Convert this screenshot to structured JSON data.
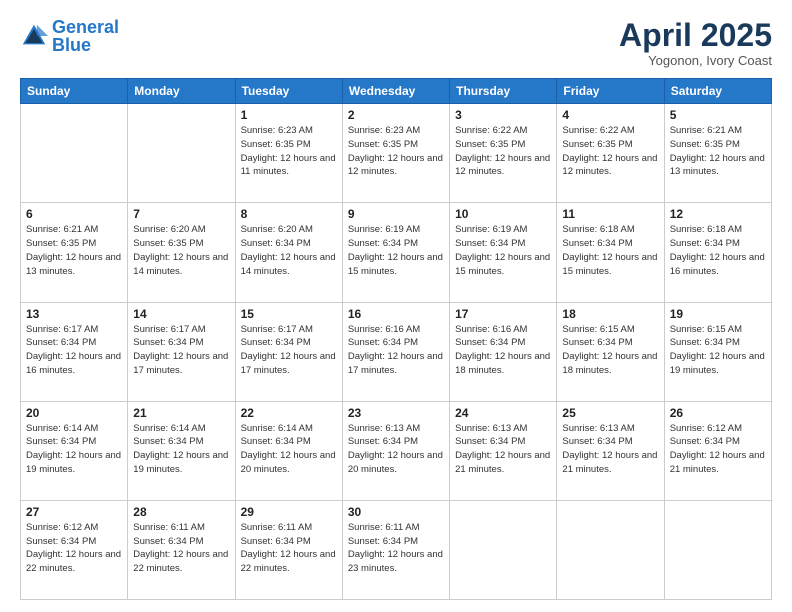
{
  "header": {
    "logo_general": "General",
    "logo_blue": "Blue",
    "title": "April 2025",
    "subtitle": "Yogonon, Ivory Coast"
  },
  "weekdays": [
    "Sunday",
    "Monday",
    "Tuesday",
    "Wednesday",
    "Thursday",
    "Friday",
    "Saturday"
  ],
  "weeks": [
    [
      {
        "day": "",
        "info": ""
      },
      {
        "day": "",
        "info": ""
      },
      {
        "day": "1",
        "info": "Sunrise: 6:23 AM\nSunset: 6:35 PM\nDaylight: 12 hours and 11 minutes."
      },
      {
        "day": "2",
        "info": "Sunrise: 6:23 AM\nSunset: 6:35 PM\nDaylight: 12 hours and 12 minutes."
      },
      {
        "day": "3",
        "info": "Sunrise: 6:22 AM\nSunset: 6:35 PM\nDaylight: 12 hours and 12 minutes."
      },
      {
        "day": "4",
        "info": "Sunrise: 6:22 AM\nSunset: 6:35 PM\nDaylight: 12 hours and 12 minutes."
      },
      {
        "day": "5",
        "info": "Sunrise: 6:21 AM\nSunset: 6:35 PM\nDaylight: 12 hours and 13 minutes."
      }
    ],
    [
      {
        "day": "6",
        "info": "Sunrise: 6:21 AM\nSunset: 6:35 PM\nDaylight: 12 hours and 13 minutes."
      },
      {
        "day": "7",
        "info": "Sunrise: 6:20 AM\nSunset: 6:35 PM\nDaylight: 12 hours and 14 minutes."
      },
      {
        "day": "8",
        "info": "Sunrise: 6:20 AM\nSunset: 6:34 PM\nDaylight: 12 hours and 14 minutes."
      },
      {
        "day": "9",
        "info": "Sunrise: 6:19 AM\nSunset: 6:34 PM\nDaylight: 12 hours and 15 minutes."
      },
      {
        "day": "10",
        "info": "Sunrise: 6:19 AM\nSunset: 6:34 PM\nDaylight: 12 hours and 15 minutes."
      },
      {
        "day": "11",
        "info": "Sunrise: 6:18 AM\nSunset: 6:34 PM\nDaylight: 12 hours and 15 minutes."
      },
      {
        "day": "12",
        "info": "Sunrise: 6:18 AM\nSunset: 6:34 PM\nDaylight: 12 hours and 16 minutes."
      }
    ],
    [
      {
        "day": "13",
        "info": "Sunrise: 6:17 AM\nSunset: 6:34 PM\nDaylight: 12 hours and 16 minutes."
      },
      {
        "day": "14",
        "info": "Sunrise: 6:17 AM\nSunset: 6:34 PM\nDaylight: 12 hours and 17 minutes."
      },
      {
        "day": "15",
        "info": "Sunrise: 6:17 AM\nSunset: 6:34 PM\nDaylight: 12 hours and 17 minutes."
      },
      {
        "day": "16",
        "info": "Sunrise: 6:16 AM\nSunset: 6:34 PM\nDaylight: 12 hours and 17 minutes."
      },
      {
        "day": "17",
        "info": "Sunrise: 6:16 AM\nSunset: 6:34 PM\nDaylight: 12 hours and 18 minutes."
      },
      {
        "day": "18",
        "info": "Sunrise: 6:15 AM\nSunset: 6:34 PM\nDaylight: 12 hours and 18 minutes."
      },
      {
        "day": "19",
        "info": "Sunrise: 6:15 AM\nSunset: 6:34 PM\nDaylight: 12 hours and 19 minutes."
      }
    ],
    [
      {
        "day": "20",
        "info": "Sunrise: 6:14 AM\nSunset: 6:34 PM\nDaylight: 12 hours and 19 minutes."
      },
      {
        "day": "21",
        "info": "Sunrise: 6:14 AM\nSunset: 6:34 PM\nDaylight: 12 hours and 19 minutes."
      },
      {
        "day": "22",
        "info": "Sunrise: 6:14 AM\nSunset: 6:34 PM\nDaylight: 12 hours and 20 minutes."
      },
      {
        "day": "23",
        "info": "Sunrise: 6:13 AM\nSunset: 6:34 PM\nDaylight: 12 hours and 20 minutes."
      },
      {
        "day": "24",
        "info": "Sunrise: 6:13 AM\nSunset: 6:34 PM\nDaylight: 12 hours and 21 minutes."
      },
      {
        "day": "25",
        "info": "Sunrise: 6:13 AM\nSunset: 6:34 PM\nDaylight: 12 hours and 21 minutes."
      },
      {
        "day": "26",
        "info": "Sunrise: 6:12 AM\nSunset: 6:34 PM\nDaylight: 12 hours and 21 minutes."
      }
    ],
    [
      {
        "day": "27",
        "info": "Sunrise: 6:12 AM\nSunset: 6:34 PM\nDaylight: 12 hours and 22 minutes."
      },
      {
        "day": "28",
        "info": "Sunrise: 6:11 AM\nSunset: 6:34 PM\nDaylight: 12 hours and 22 minutes."
      },
      {
        "day": "29",
        "info": "Sunrise: 6:11 AM\nSunset: 6:34 PM\nDaylight: 12 hours and 22 minutes."
      },
      {
        "day": "30",
        "info": "Sunrise: 6:11 AM\nSunset: 6:34 PM\nDaylight: 12 hours and 23 minutes."
      },
      {
        "day": "",
        "info": ""
      },
      {
        "day": "",
        "info": ""
      },
      {
        "day": "",
        "info": ""
      }
    ]
  ]
}
